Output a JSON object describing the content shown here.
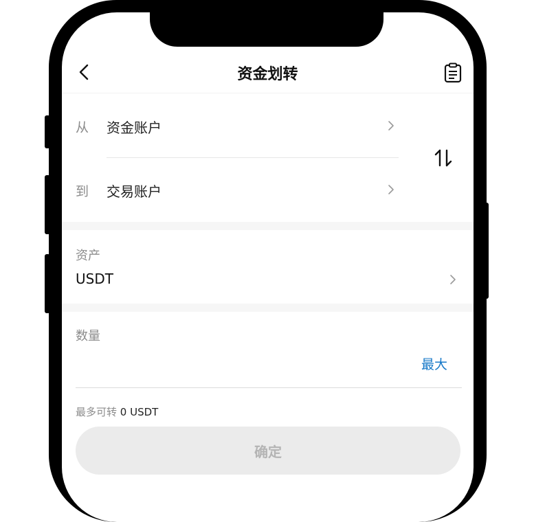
{
  "header": {
    "title": "资金划转"
  },
  "transfer": {
    "from_label": "从",
    "from_value": "资金账户",
    "to_label": "到",
    "to_value": "交易账户"
  },
  "asset": {
    "label": "资产",
    "value": "USDT"
  },
  "amount": {
    "label": "数量",
    "max_label": "最大",
    "available_label": "最多可转",
    "available_value": "0 USDT"
  },
  "confirm_label": "确定",
  "colors": {
    "accent": "#1779c8",
    "disabled_button_bg": "#ebebeb",
    "disabled_button_text": "#b4b4b4"
  },
  "icons": [
    "back-icon",
    "records-icon",
    "chevron-right-icon",
    "swap-icon"
  ]
}
